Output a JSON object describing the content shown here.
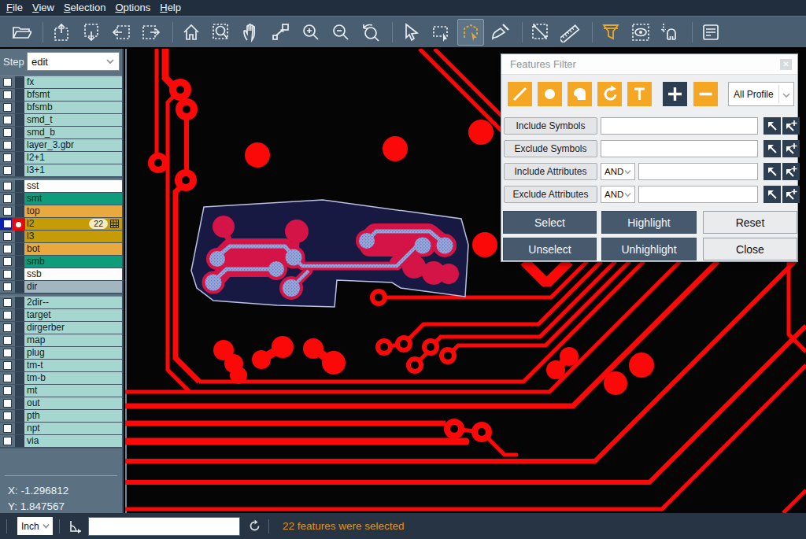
{
  "menu": {
    "items": [
      "File",
      "View",
      "Selection",
      "Options",
      "Help"
    ]
  },
  "toolbar": {
    "icons": [
      "open-folder",
      "pan-up",
      "pan-down",
      "pan-left",
      "pan-right",
      "home",
      "zoom-area",
      "pan-hand",
      "move-feature",
      "zoom-in",
      "zoom-out",
      "zoom-previous",
      "select-cursor",
      "select-rectangle",
      "select-polygon",
      "clear-highlight-brush",
      "select-line",
      "measure-ruler",
      "features-filter",
      "view-options",
      "snap-magnet",
      "log-panel"
    ],
    "active_icon": "select-polygon"
  },
  "sidebar": {
    "step_label": "Step",
    "step_value": "edit",
    "groups": [
      {
        "items": [
          {
            "label": "fx",
            "color": "teal"
          },
          {
            "label": "bfsmt",
            "color": "teal"
          },
          {
            "label": "bfsmb",
            "color": "teal"
          },
          {
            "label": "smd_t",
            "color": "teal"
          },
          {
            "label": "smd_b",
            "color": "teal"
          },
          {
            "label": "layer_3.gbr",
            "color": "teal"
          },
          {
            "label": "l2+1",
            "color": "teal"
          },
          {
            "label": "l3+1",
            "color": "teal"
          }
        ]
      },
      {
        "items": [
          {
            "label": "sst",
            "color": "white"
          },
          {
            "label": "smt",
            "color": "green"
          },
          {
            "label": "top",
            "color": "amber"
          },
          {
            "label": "l2",
            "color": "gold",
            "checked": true,
            "active": true,
            "badge": "22",
            "grid": true
          },
          {
            "label": "l3",
            "color": "gold"
          },
          {
            "label": "bot",
            "color": "amber"
          },
          {
            "label": "smb",
            "color": "green"
          },
          {
            "label": "ssb",
            "color": "white"
          },
          {
            "label": "dir",
            "color": "gray"
          }
        ]
      },
      {
        "items": [
          {
            "label": "2dir--",
            "color": "teal"
          },
          {
            "label": "target",
            "color": "teal"
          },
          {
            "label": "dirgerber",
            "color": "teal"
          },
          {
            "label": "map",
            "color": "teal"
          },
          {
            "label": "plug",
            "color": "teal"
          },
          {
            "label": "tm-t",
            "color": "teal"
          },
          {
            "label": "tm-b",
            "color": "teal"
          },
          {
            "label": "mt",
            "color": "teal"
          },
          {
            "label": "out",
            "color": "teal"
          },
          {
            "label": "pth",
            "color": "teal"
          },
          {
            "label": "npt",
            "color": "teal"
          },
          {
            "label": "via",
            "color": "teal"
          }
        ]
      }
    ],
    "cursor_x": "X: -1.296812",
    "cursor_y": "Y: 1.847567"
  },
  "dialog": {
    "title": "Features Filter",
    "tools": [
      "lines",
      "pads",
      "surfaces",
      "arcs",
      "text"
    ],
    "add_label": "+",
    "remove_label": "−",
    "profile_value": "All Profile",
    "rows": [
      {
        "label": "Include Symbols",
        "has_and": false,
        "value": ""
      },
      {
        "label": "Exclude Symbols",
        "has_and": false,
        "value": ""
      },
      {
        "label": "Include Attributes",
        "has_and": true,
        "and_value": "AND",
        "value": ""
      },
      {
        "label": "Exclude Attributes",
        "has_and": true,
        "and_value": "AND",
        "value": ""
      }
    ],
    "buttons": [
      {
        "label": "Select",
        "style": "dark"
      },
      {
        "label": "Highlight",
        "style": "dark"
      },
      {
        "label": "Reset",
        "style": "light"
      },
      {
        "label": "Unselect",
        "style": "dark"
      },
      {
        "label": "Unhighlight",
        "style": "dark"
      },
      {
        "label": "Close",
        "style": "light"
      }
    ]
  },
  "statusbar": {
    "unit_value": "Inch",
    "input_value": "",
    "message": "22 features were selected"
  },
  "canvas": {
    "trace_color": "#fb0808",
    "selection_fill": "#191b4a",
    "selection_border": "#b9c0e2",
    "highlight_color": "#d41347",
    "hatch_color": "#98a6da"
  }
}
